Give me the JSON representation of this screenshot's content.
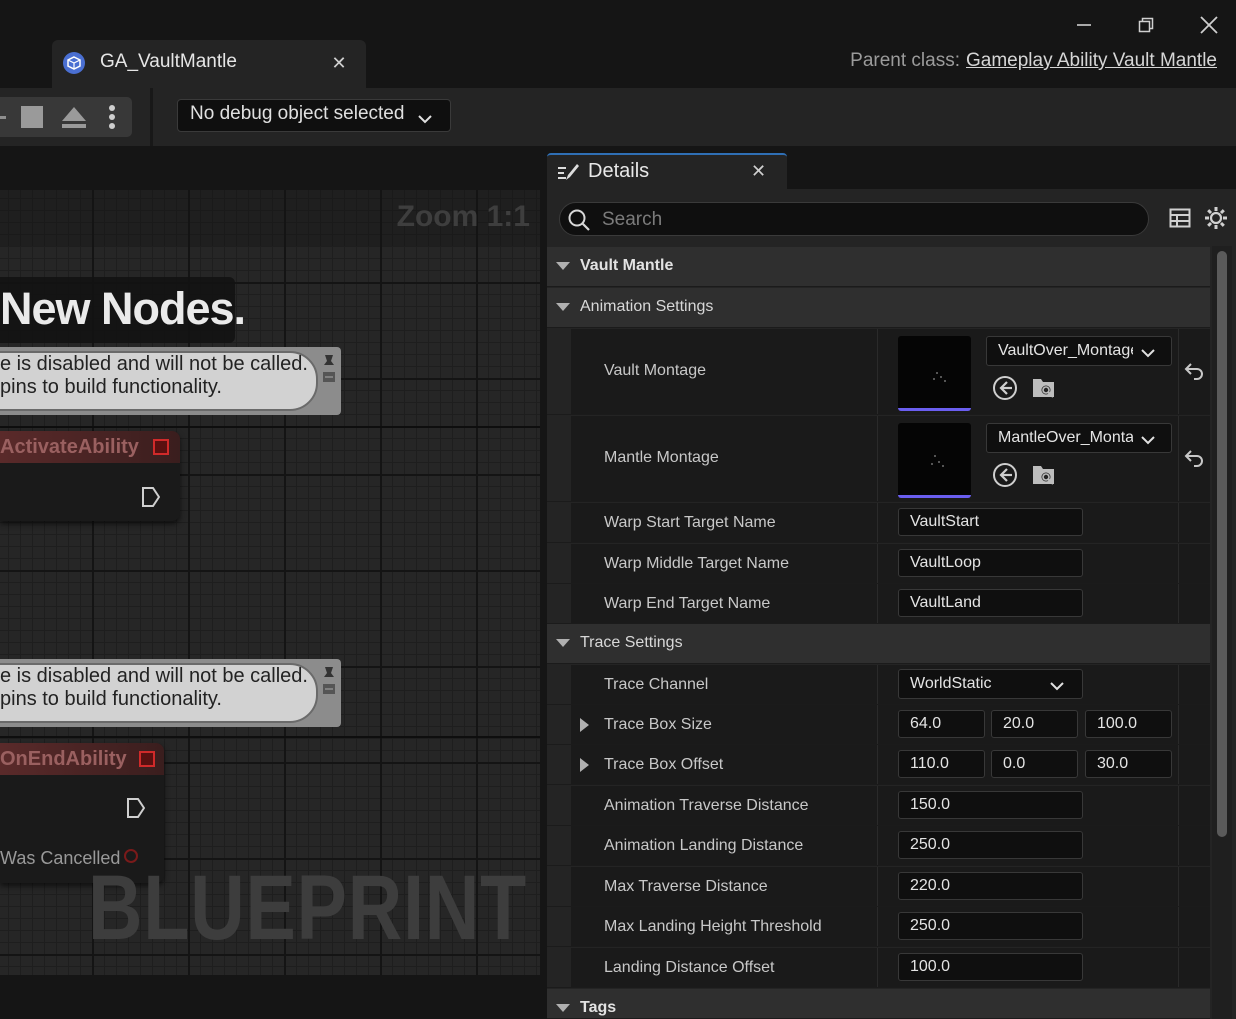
{
  "window": {
    "tab_title": "GA_VaultMantle",
    "parent_class_label": "Parent class:",
    "parent_class_value": "Gameplay Ability Vault Mantle"
  },
  "toolbar": {
    "debug_select": "No debug object selected"
  },
  "graph": {
    "zoom": "Zoom 1:1",
    "comment_title": "New Nodes.",
    "disabled_note_line1": "e is disabled and will not be called.",
    "disabled_note_line2": "pins to build functionality.",
    "node_activate": "ActivateAbility",
    "node_end": "OnEndAbility",
    "was_cancelled": "Was Cancelled",
    "watermark": "BLUEPRINT"
  },
  "details": {
    "tab_label": "Details",
    "search_placeholder": "Search",
    "categories": {
      "vault_mantle": "Vault Mantle",
      "animation_settings": "Animation Settings",
      "trace_settings": "Trace Settings",
      "tags": "Tags"
    },
    "vault_montage": {
      "label": "Vault Montage",
      "value": "VaultOver_Montage"
    },
    "mantle_montage": {
      "label": "Mantle Montage",
      "value": "MantleOver_Montage"
    },
    "warp_start": {
      "label": "Warp Start Target Name",
      "value": "VaultStart"
    },
    "warp_middle": {
      "label": "Warp Middle Target Name",
      "value": "VaultLoop"
    },
    "warp_end": {
      "label": "Warp End Target Name",
      "value": "VaultLand"
    },
    "trace_channel": {
      "label": "Trace Channel",
      "value": "WorldStatic"
    },
    "trace_box_size": {
      "label": "Trace Box Size",
      "x": "64.0",
      "y": "20.0",
      "z": "100.0"
    },
    "trace_box_offset": {
      "label": "Trace Box Offset",
      "x": "110.0",
      "y": "0.0",
      "z": "30.0"
    },
    "anim_traverse": {
      "label": "Animation Traverse Distance",
      "value": "150.0"
    },
    "anim_landing": {
      "label": "Animation Landing Distance",
      "value": "250.0"
    },
    "max_traverse": {
      "label": "Max Traverse Distance",
      "value": "220.0"
    },
    "max_landing_height": {
      "label": "Max Landing Height Threshold",
      "value": "250.0"
    },
    "landing_offset": {
      "label": "Landing Distance Offset",
      "value": "100.0"
    }
  },
  "colors": {
    "accent": "#2f6fb5",
    "thumb_underline": "#6a5ef0",
    "event_pin": "#d02a2a"
  }
}
